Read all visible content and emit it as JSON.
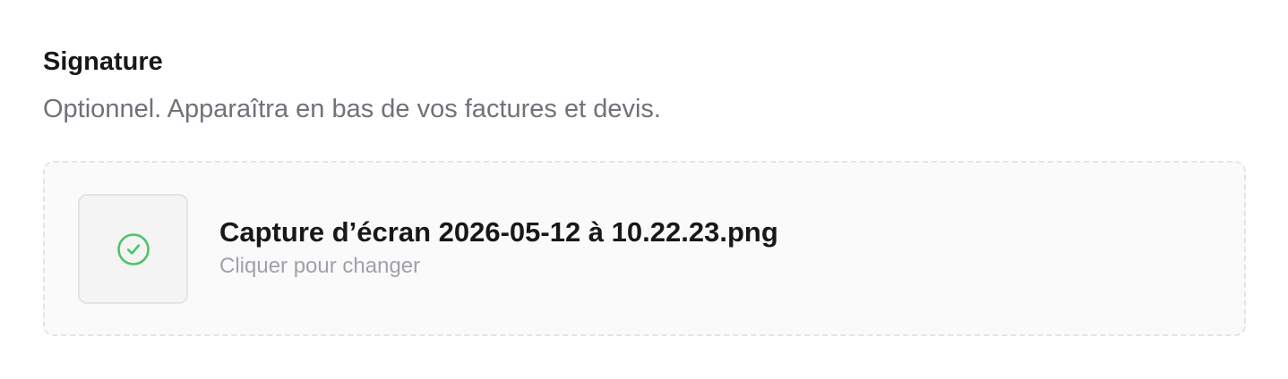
{
  "section": {
    "title": "Signature",
    "description": "Optionnel. Apparaîtra en bas de vos factures et devis."
  },
  "upload": {
    "file_name": "Capture d’écran 2026-05-12 à 10.22.23.png",
    "hint": "Cliquer pour changer",
    "status_icon": "check-circle-icon"
  },
  "colors": {
    "success": "#4ac564",
    "muted_text": "#71717a",
    "hint_text": "#a1a1aa",
    "box_border": "#e4e4e7",
    "box_background": "#fafafa"
  }
}
